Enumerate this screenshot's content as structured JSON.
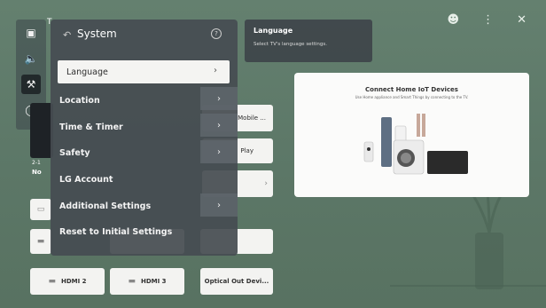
{
  "top_icons": {
    "user": "person-icon",
    "more": "⋮",
    "close": "✕"
  },
  "rail": {
    "icons": [
      "input-icon",
      "sound-icon",
      "wrench-icon",
      "support-icon"
    ]
  },
  "system_panel": {
    "title": "System",
    "help": "?",
    "items": [
      {
        "label": "Language",
        "has_chevron": true,
        "selected": true
      },
      {
        "label": "Location",
        "has_chevron": true
      },
      {
        "label": "Time & Timer",
        "has_chevron": true
      },
      {
        "label": "Safety",
        "has_chevron": true
      },
      {
        "label": "LG Account",
        "has_chevron": false
      },
      {
        "label": "Additional Settings",
        "has_chevron": true
      },
      {
        "label": "Reset to Initial Settings",
        "has_chevron": false
      }
    ]
  },
  "tooltip": {
    "title": "Language",
    "description": "Select TV's language settings."
  },
  "iot_card": {
    "title": "Connect Home IoT Devices",
    "subtitle": "Use Home appliance and Smart Things by connecting to the TV."
  },
  "tiles": {
    "mobile": "Mobile ...",
    "play": "Play",
    "channel_num": "2-1",
    "channel_name": "No",
    "hdmi2": "HDMI 2",
    "hdmi3": "HDMI 3",
    "optical": "Optical Out Devi..."
  },
  "header_letter": "T",
  "colors": {
    "background": "#5f7a6b",
    "panel": "#464c52",
    "selected": "#f4f4f2"
  }
}
